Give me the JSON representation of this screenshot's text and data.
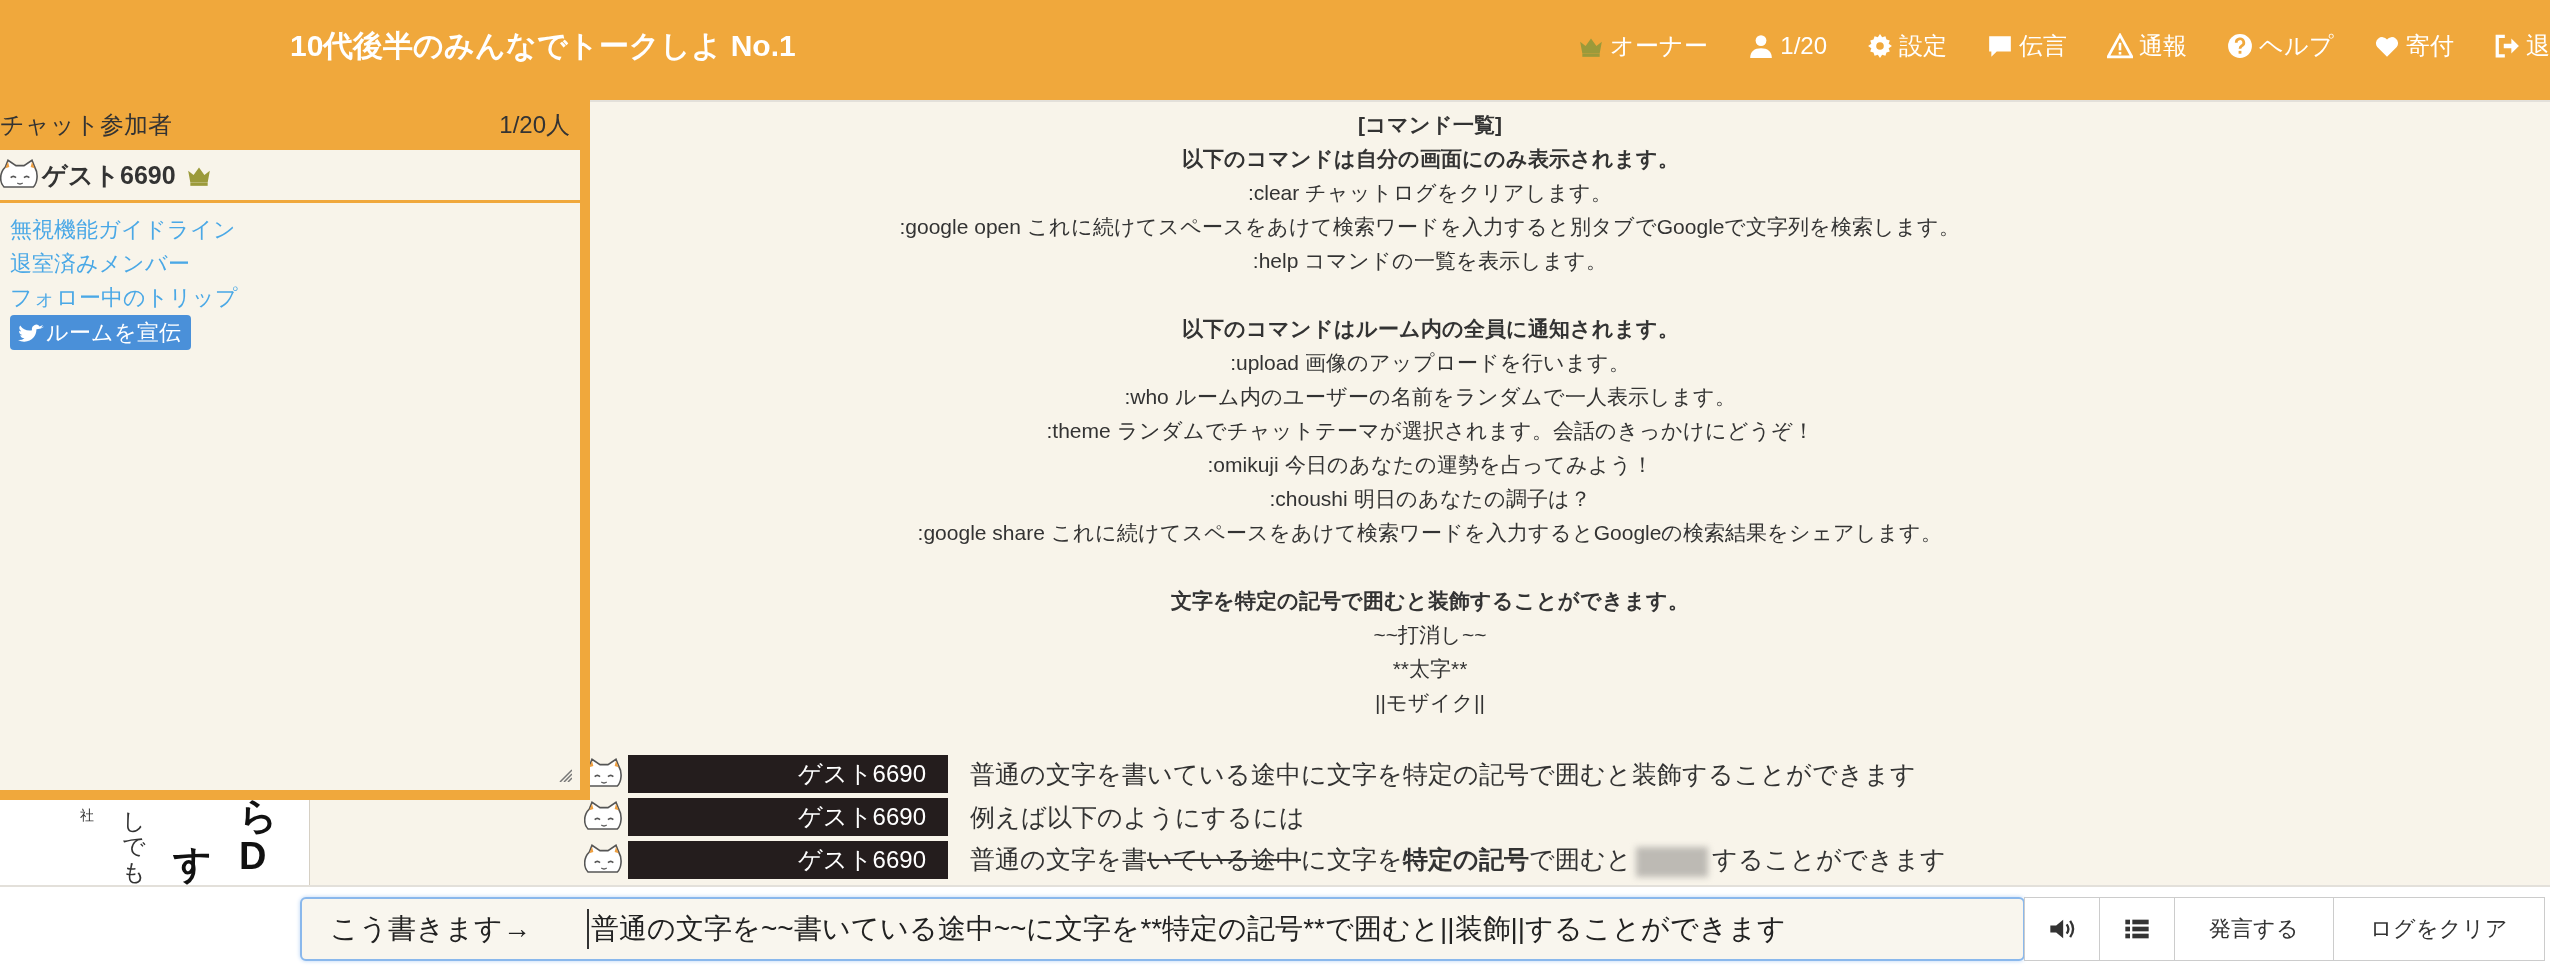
{
  "header": {
    "title": "10代後半のみんなでトークしよ No.1",
    "nav": [
      {
        "kind": "owner",
        "label": "オーナー"
      },
      {
        "kind": "users",
        "label": "1/20"
      },
      {
        "kind": "settings",
        "label": "設定"
      },
      {
        "kind": "message",
        "label": "伝言"
      },
      {
        "kind": "report",
        "label": "通報"
      },
      {
        "kind": "help",
        "label": "ヘルプ"
      },
      {
        "kind": "donate",
        "label": "寄付"
      },
      {
        "kind": "exit",
        "label": "退"
      }
    ]
  },
  "sidebar": {
    "title": "チャット参加者",
    "count": "1/20人",
    "members": [
      {
        "name": "ゲスト6690",
        "owner": true
      }
    ],
    "links": [
      "無視機能ガイドライン",
      "退室済みメンバー",
      "フォロー中のトリップ"
    ],
    "share_button": "ルームを宣伝"
  },
  "ad_fragments": [
    {
      "kind": "small",
      "text": "社"
    },
    {
      "kind": "regular",
      "text": "しでも"
    },
    {
      "kind": "bold",
      "text": "す"
    },
    {
      "kind": "bold",
      "text": "らD"
    }
  ],
  "commands": [
    {
      "lines": [
        {
          "text": "[コマンド一覧]",
          "bold": true
        },
        {
          "text": "以下のコマンドは自分の画面にのみ表示されます。",
          "bold": true
        },
        {
          "text": ":clear チャットログをクリアします。",
          "bold": false
        },
        {
          "text": ":google open これに続けてスペースをあけて検索ワードを入力すると別タブでGoogleで文字列を検索します。",
          "bold": false
        },
        {
          "text": ":help コマンドの一覧を表示します。",
          "bold": false
        }
      ]
    },
    {
      "lines": [
        {
          "text": "以下のコマンドはルーム内の全員に通知されます。",
          "bold": true
        },
        {
          "text": ":upload 画像のアップロードを行います。",
          "bold": false
        },
        {
          "text": ":who ルーム内のユーザーの名前をランダムで一人表示します。",
          "bold": false
        },
        {
          "text": ":theme ランダムでチャットテーマが選択されます。会話のきっかけにどうぞ！",
          "bold": false
        },
        {
          "text": ":omikuji 今日のあなたの運勢を占ってみよう！",
          "bold": false
        },
        {
          "text": ":choushi 明日のあなたの調子は？",
          "bold": false
        },
        {
          "text": ":google share これに続けてスペースをあけて検索ワードを入力するとGoogleの検索結果をシェアします。",
          "bold": false
        }
      ]
    },
    {
      "lines": [
        {
          "text": "文字を特定の記号で囲むと装飾することができます。",
          "bold": true
        },
        {
          "text": "~~打消し~~",
          "bold": false
        },
        {
          "text": "**太字**",
          "bold": false
        },
        {
          "text": "||モザイク||",
          "bold": false
        }
      ]
    }
  ],
  "messages": [
    {
      "author": "ゲスト6690",
      "segments": [
        {
          "kind": "plain",
          "text": "普通の文字を書いている途中に文字を特定の記号で囲むと装飾することができます"
        }
      ]
    },
    {
      "author": "ゲスト6690",
      "segments": [
        {
          "kind": "plain",
          "text": "例えば以下のようにするには"
        }
      ]
    },
    {
      "author": "ゲスト6690",
      "segments": [
        {
          "kind": "plain",
          "text": "普通の文字を書"
        },
        {
          "kind": "strike",
          "text": "いている途中"
        },
        {
          "kind": "plain",
          "text": "に文字を"
        },
        {
          "kind": "bold",
          "text": "特定の記号"
        },
        {
          "kind": "plain",
          "text": "で囲むと"
        },
        {
          "kind": "mosaic"
        },
        {
          "kind": "plain",
          "text": "することができます"
        }
      ]
    }
  ],
  "composer": {
    "annotation": "こう書きます→",
    "value": "普通の文字を~~書いている途中~~に文字を**特定の記号**で囲むと||装飾||することができます",
    "buttons": [
      {
        "kind": "sound"
      },
      {
        "kind": "list"
      },
      {
        "kind": "text",
        "label": "発言する"
      },
      {
        "kind": "text",
        "label": "ログをクリア"
      }
    ]
  }
}
